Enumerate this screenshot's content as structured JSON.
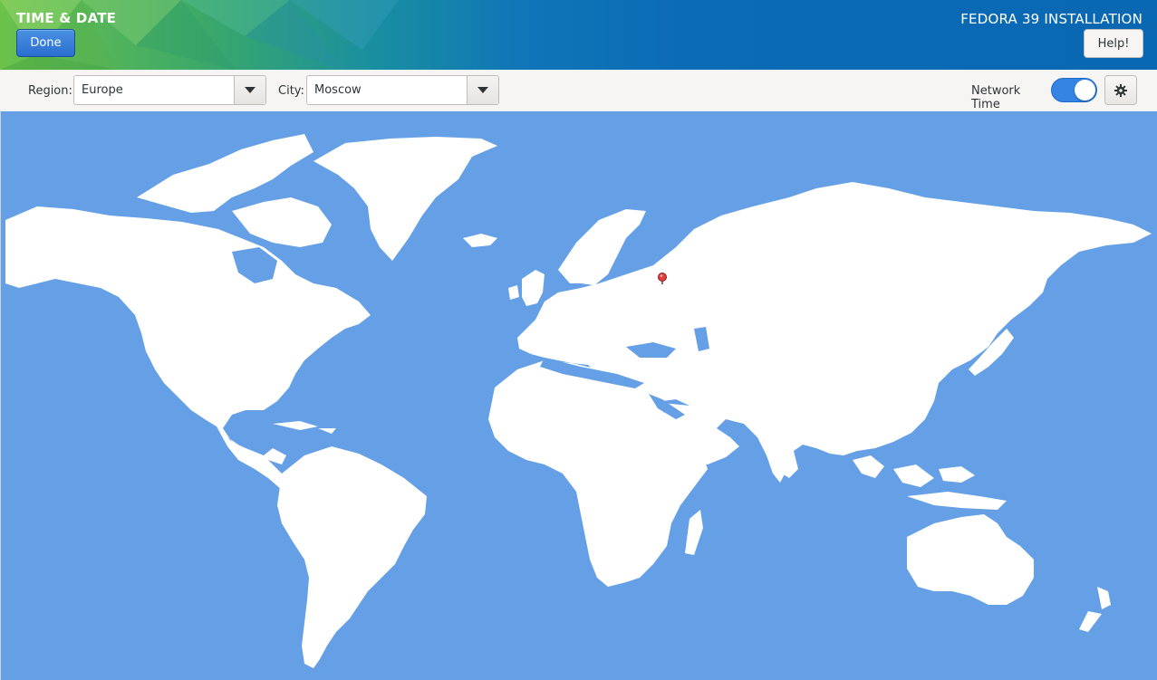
{
  "header": {
    "screen_title": "TIME & DATE",
    "done_label": "Done",
    "install_title": "FEDORA 39 INSTALLATION",
    "help_label": "Help!"
  },
  "toolbar": {
    "region_label": "Region:",
    "region_value": "Europe",
    "city_label": "City:",
    "city_value": "Moscow",
    "network_time_label": "Network Time",
    "network_time_enabled": true
  },
  "icons": {
    "dropdown": "chevron-down-icon",
    "settings": "gear-icon",
    "location_pin": "map-pin-icon"
  },
  "colors": {
    "ocean": "#65a0e6",
    "land": "#ffffff",
    "accent": "#3584e4",
    "pin": "#e04040"
  }
}
